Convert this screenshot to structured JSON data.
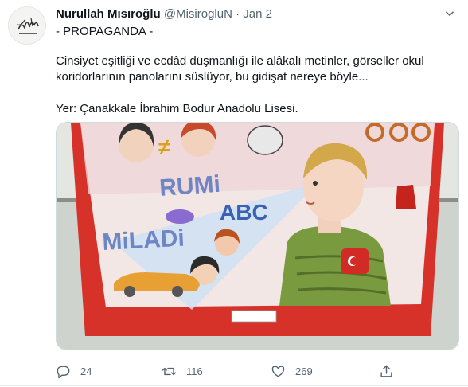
{
  "tweet": {
    "author_name": "Nurullah Mısıroğlu",
    "handle": "@MisirogluN",
    "separator": "·",
    "date": "Jan 2",
    "subtitle": "- PROPAGANDA -",
    "body_line1": "Cinsiyet eşitliği ve ecdâd düşmanlığı ile alâkalı metinler, görseller okul koridorlarının panolarını süslüyor, bu gidişat nereye böyle...",
    "body_line2": "Yer: Çanakkale İbrahim Bodur Anadolu Lisesi.",
    "avatar_icon": "calligraphy-logo-icon",
    "menu_icon": "chevron-down-icon"
  },
  "media": {
    "description_icon": "school-poster-image",
    "poster_words": {
      "rumi": "RUMi",
      "abc": "ABC",
      "miladi": "MiLADi",
      "not_equal": "≠"
    }
  },
  "actions": {
    "reply_count": "24",
    "retweet_count": "116",
    "like_count": "269",
    "icons": [
      "reply-icon",
      "retweet-icon",
      "like-icon",
      "share-icon"
    ]
  },
  "colors": {
    "text": "#0f1419",
    "secondary": "#536471",
    "poster_red": "#d7322a"
  }
}
